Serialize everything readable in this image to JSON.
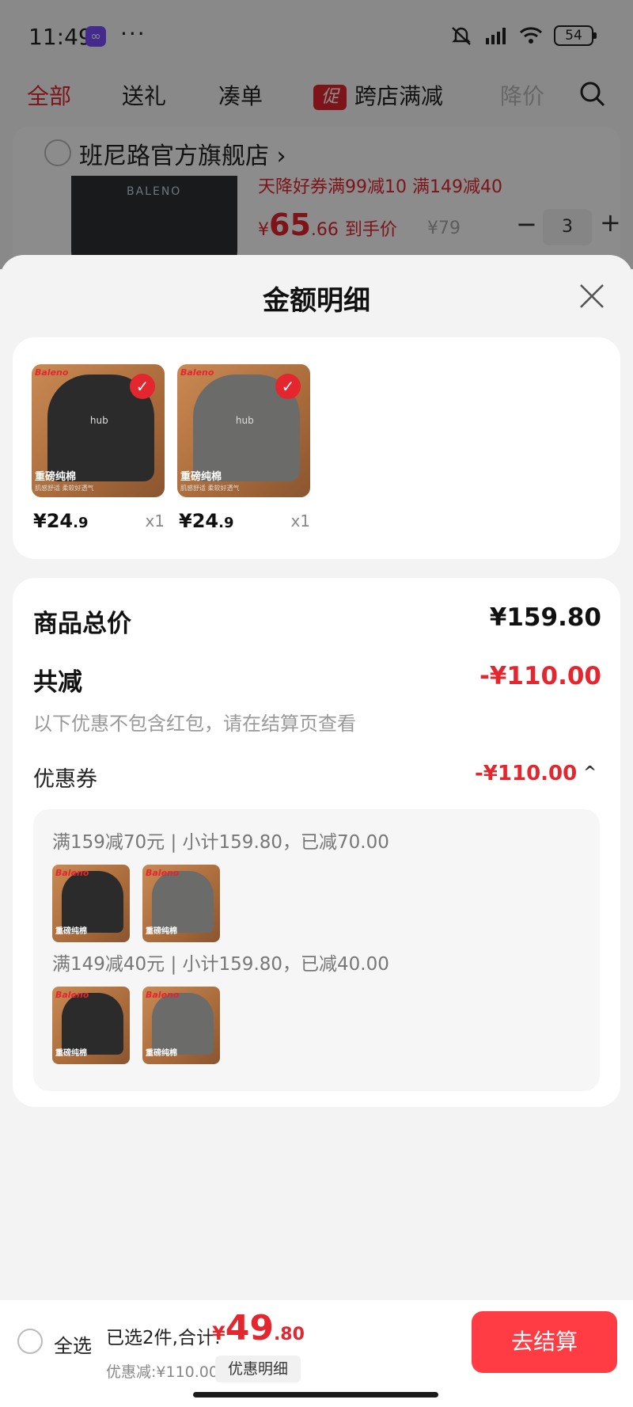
{
  "status_bar": {
    "time": "11:49",
    "dots": "···",
    "battery": "54"
  },
  "nav_tabs": [
    "全部",
    "送礼",
    "凑单",
    "跨店满减",
    "降价"
  ],
  "nav_promo_badge": "促",
  "shop": {
    "name": "班尼路官方旗舰店",
    "name_arrow": "›",
    "thumb_brand": "BALENO",
    "coupon_text": "天降好券满99减10  满149减40",
    "price_symbol": "¥",
    "price_int": "65",
    "price_dec": ".66",
    "price_label": "到手价",
    "orig_price": "¥79",
    "qty": "3",
    "minus": "−",
    "plus": "+"
  },
  "sheet": {
    "title": "金额明细",
    "products": [
      {
        "price_int": "¥24",
        "price_dec": ".9",
        "qty": "x1",
        "color": "black",
        "check": "✓",
        "logo": "Baleno",
        "tag": "重磅纯棉",
        "sub": "肌感舒适 柔软好透气",
        "print": "hub"
      },
      {
        "price_int": "¥24",
        "price_dec": ".9",
        "qty": "x1",
        "color": "grey",
        "check": "✓",
        "logo": "Baleno",
        "tag": "重磅纯棉",
        "sub": "肌感舒适 柔软好透气",
        "print": "hub"
      }
    ],
    "summary": {
      "total_label": "商品总价",
      "total_value": "¥159.80",
      "discount_label": "共减",
      "discount_value": "-¥110.00",
      "note": "以下优惠不包含红包，请在结算页查看",
      "coupon_label": "优惠券",
      "coupon_value": "-¥110.00",
      "coupon_chevron": "^",
      "coupons": [
        {
          "rule": "满159减70元 | 小计159.80，已减70.00"
        },
        {
          "rule": "满149减40元 | 小计159.80，已减40.00"
        }
      ],
      "thumb_tag": "重磅纯棉",
      "thumb_logo": "Baleno"
    }
  },
  "footer": {
    "select_all": "全选",
    "selected_text": "已选2件,合计:",
    "total_symbol": "¥",
    "total_int": "49",
    "total_dec": ".80",
    "discount_text": "优惠减:¥110.00",
    "detail_button": "优惠明细",
    "checkout": "去结算"
  },
  "colors": {
    "accent": "#e4262f",
    "checkout": "#ff3b44"
  }
}
